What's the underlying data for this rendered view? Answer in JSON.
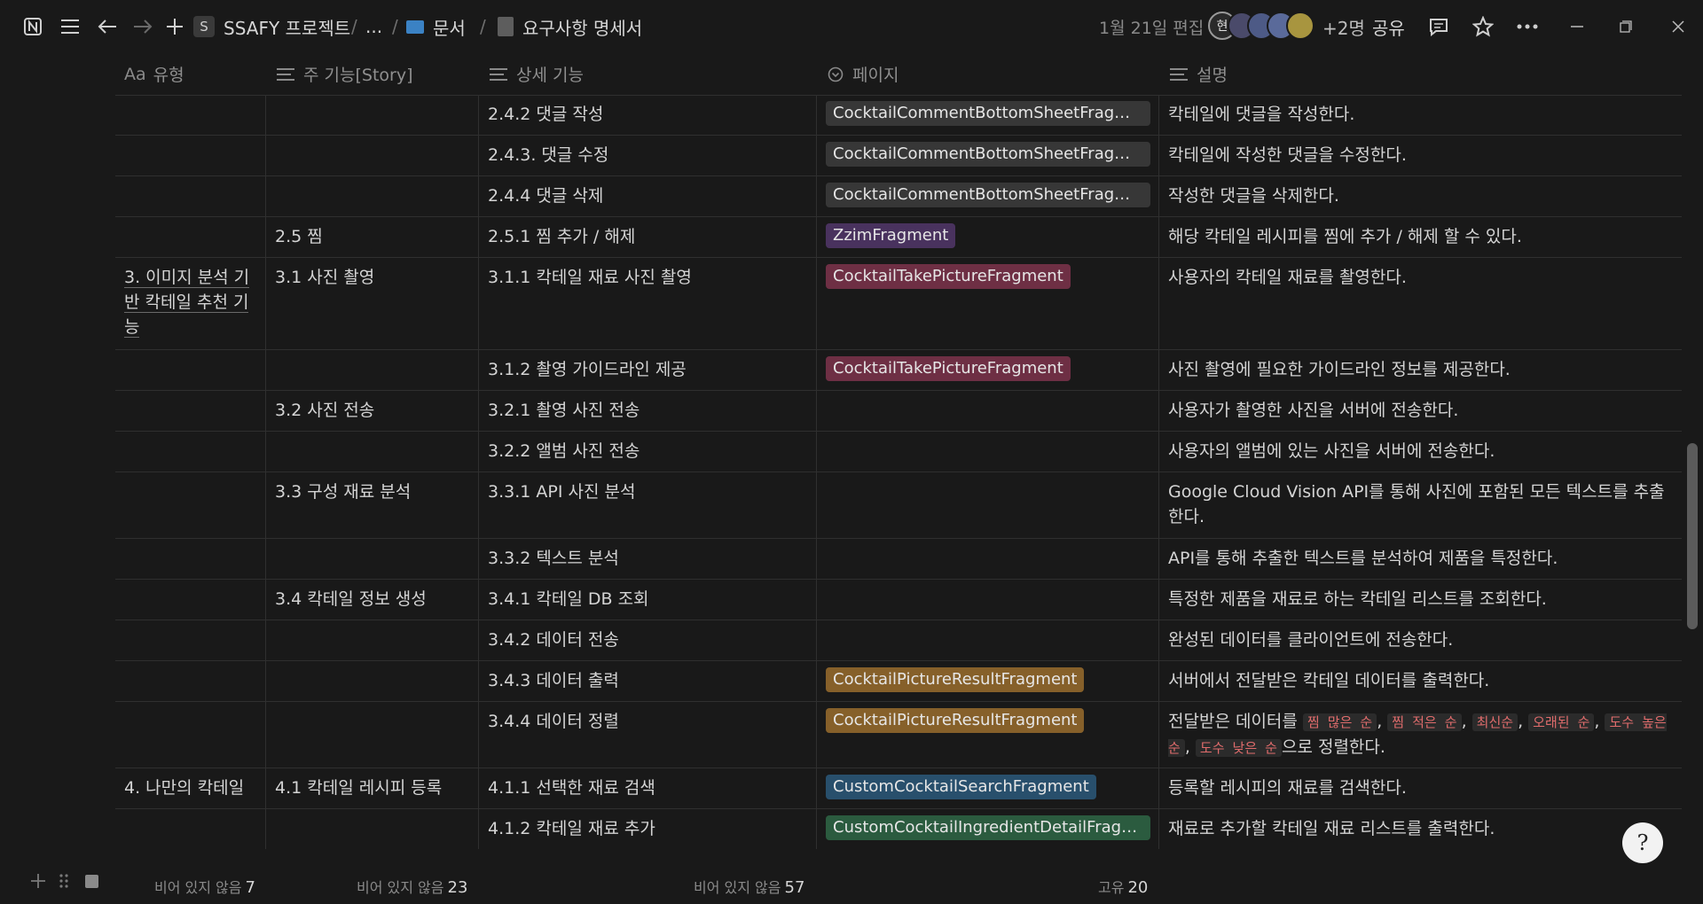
{
  "topbar": {
    "workspace_badge": "S",
    "workspace": "SSAFY 프로젝트",
    "ellipsis": "...",
    "folder": "문서",
    "page_title": "요구사항 명세서",
    "edited": "1월 21일 편집",
    "avatar_initial": "현",
    "extra_members": "+2명",
    "share": "공유",
    "icons": [
      "notion-logo-icon",
      "hamburger-menu-icon",
      "back-arrow-icon",
      "forward-arrow-icon",
      "plus-icon",
      "folder-icon",
      "document-icon",
      "comment-icon",
      "star-icon",
      "more-icon",
      "minimize-icon",
      "restore-icon",
      "close-icon"
    ]
  },
  "columns": {
    "type": "유형",
    "type_prefix": "Aa",
    "main_feature": "주 기능[Story]",
    "detail_feature": "상세 기능",
    "page": "페이지",
    "description": "설명"
  },
  "rows": [
    {
      "type": "",
      "main": "",
      "detail": "2.4.2 댓글 작성",
      "page": "CocktailCommentBottomSheetFragment",
      "page_color": "#373737",
      "desc": "칵테일에 댓글을 작성한다."
    },
    {
      "type": "",
      "main": "",
      "detail": "2.4.3. 댓글 수정",
      "page": "CocktailCommentBottomSheetFragment",
      "page_color": "#373737",
      "desc": "칵테일에 작성한 댓글을 수정한다."
    },
    {
      "type": "",
      "main": "",
      "detail": "2.4.4 댓글  삭제",
      "page": "CocktailCommentBottomSheetFragment",
      "page_color": "#373737",
      "desc": "작성한 댓글을 삭제한다."
    },
    {
      "type": "",
      "main": "2.5 찜",
      "detail": "2.5.1 찜 추가 / 해제",
      "page": "ZzimFragment",
      "page_color": "#49325e",
      "desc": "해당 칵테일 레시피를 찜에 추가 / 해제 할 수 있다."
    },
    {
      "type": "3. 이미지 분석 기반 칵테일 추천 기능",
      "main": "3.1 사진 촬영",
      "detail": "3.1.1 칵테일 재료 사진 촬영",
      "page": "CocktailTakePictureFragment",
      "page_color": "#6e2f44",
      "desc": "사용자의 칵테일 재료를 촬영한다."
    },
    {
      "type": "",
      "main": "",
      "detail": "3.1.2 촬영 가이드라인 제공",
      "page": "CocktailTakePictureFragment",
      "page_color": "#6e2f44",
      "desc": "사진 촬영에 필요한 가이드라인 정보를 제공한다."
    },
    {
      "type": "",
      "main": "3.2 사진 전송",
      "detail": "3.2.1 촬영 사진 전송",
      "page": "",
      "page_color": "",
      "desc": "사용자가 촬영한 사진을 서버에 전송한다."
    },
    {
      "type": "",
      "main": "",
      "detail": "3.2.2 앨범 사진 전송",
      "page": "",
      "page_color": "",
      "desc": "사용자의 앨범에 있는 사진을 서버에 전송한다."
    },
    {
      "type": "",
      "main": "3.3 구성 재료 분석",
      "detail": "3.3.1 API 사진 분석",
      "page": "",
      "page_color": "",
      "desc": "Google Cloud Vision API를 통해 사진에 포함된 모든 텍스트를 추출한다."
    },
    {
      "type": "",
      "main": "",
      "detail": "3.3.2 텍스트 분석",
      "page": "",
      "page_color": "",
      "desc": "API를 통해 추출한 텍스트를 분석하여 제품을 특정한다."
    },
    {
      "type": "",
      "main": "3.4 칵테일 정보 생성",
      "detail": "3.4.1 칵테일 DB 조회",
      "page": "",
      "page_color": "",
      "desc": "특정한 제품을 재료로 하는 칵테일 리스트를 조회한다."
    },
    {
      "type": "",
      "main": "",
      "detail": "3.4.2 데이터 전송",
      "page": "",
      "page_color": "",
      "desc": "완성된 데이터를 클라이언트에 전송한다."
    },
    {
      "type": "",
      "main": "",
      "detail": "3.4.3 데이터 출력",
      "page": "CocktailPictureResultFragment",
      "page_color": "#86602a",
      "desc": "서버에서 전달받은 칵테일 데이터를 출력한다."
    },
    {
      "type": "",
      "main": "",
      "detail": "3.4.4 데이터 정렬",
      "page": "CocktailPictureResultFragment",
      "page_color": "#86602a",
      "desc": ""
    },
    {
      "type": "4. 나만의 칵테일",
      "main": "4.1 칵테일 레시피 등록",
      "detail": "4.1.1 선택한 재료 검색",
      "page": "CustomCocktailSearchFragment",
      "page_color": "#284f6c",
      "desc": "등록할 레시피의 재료를 검색한다."
    },
    {
      "type": "",
      "main": "",
      "detail": "4.1.2 칵테일 재료 추가",
      "page": "CustomCocktailIngredientDetailFragm...",
      "page_color": "#2b5b3f",
      "desc": "재료로 추가할 칵테일 재료 리스트를 출력한다."
    }
  ],
  "sort_desc": {
    "prefix": "전달받은 데이터를",
    "options": [
      "찜 많은 순",
      "찜 적은 순",
      "최신순",
      "오래된 순",
      "도수 높은 순",
      "도수 낮은 순"
    ],
    "suffix": "으로 정렬한다."
  },
  "footer": {
    "type_label": "비어 있지 않음",
    "type_count": "7",
    "main_label": "비어 있지 않음",
    "main_count": "23",
    "detail_label": "비어 있지 않음",
    "detail_count": "57",
    "page_label": "고유",
    "page_count": "20"
  },
  "help_glyph": "?"
}
